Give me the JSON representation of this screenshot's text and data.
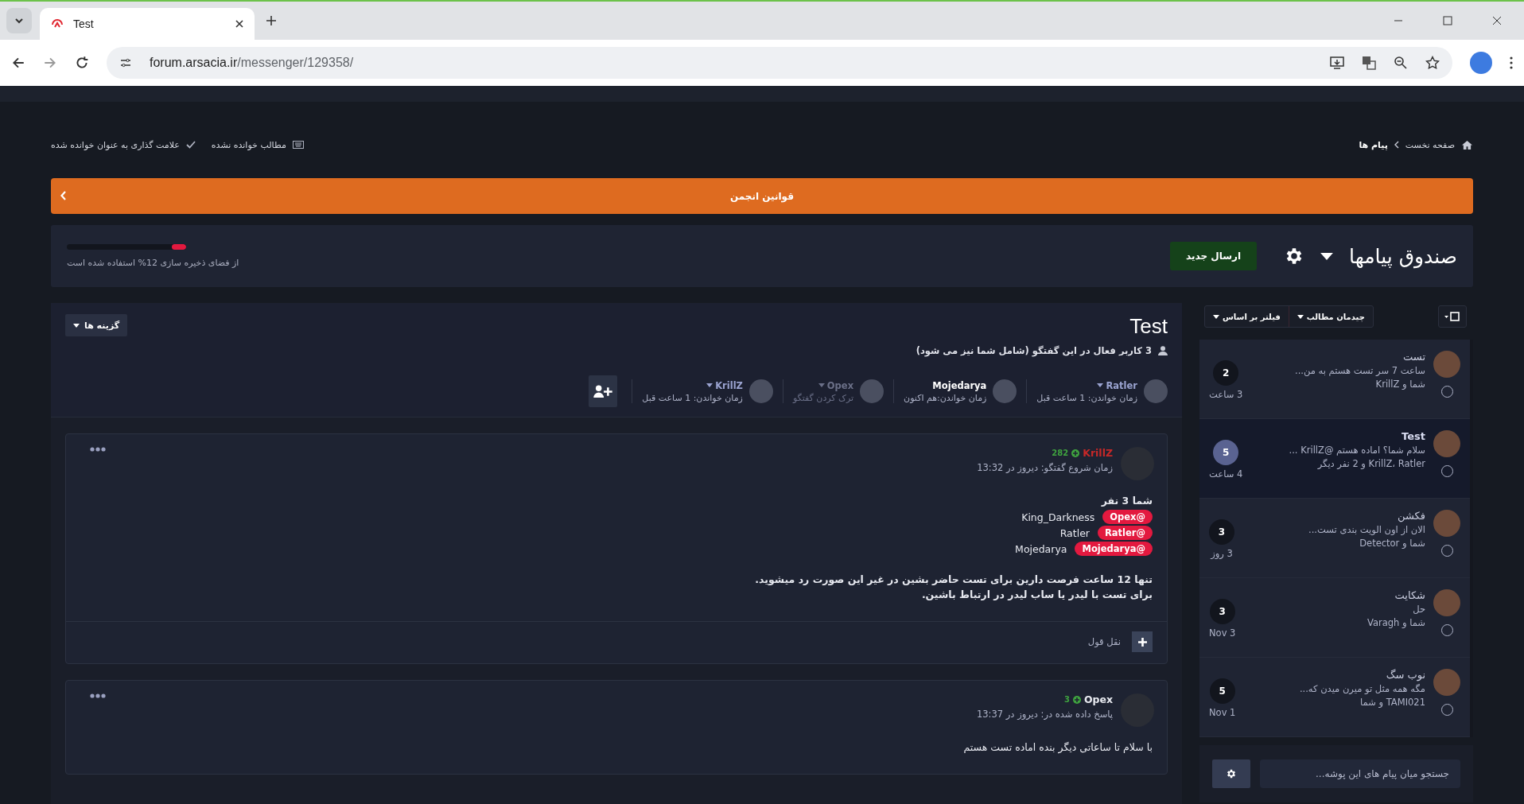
{
  "browser": {
    "tabs": [
      {
        "title": "Test",
        "selected": true
      }
    ],
    "url_host": "forum.arsacia.ir",
    "url_path": "/messenger/129358/"
  },
  "breadcrumb": [
    {
      "label": "صفحه نخست",
      "current": false
    },
    {
      "label": "پیام ها",
      "current": true
    }
  ],
  "top_links": [
    {
      "kind": "unread",
      "label": "مطالب خوانده نشده"
    },
    {
      "kind": "mark",
      "label": "علامت گذاری به عنوان خوانده شده"
    }
  ],
  "notice": {
    "label": "قوانین انجمن"
  },
  "inbox": {
    "title": "صندوق پیامها",
    "new_button": "ارسال جدید",
    "storage": {
      "level": 0.12,
      "text": "از فضای ذخیره سازی 12% استفاده شده است"
    }
  },
  "sidebar": {
    "toolbar": [
      "چیدمان مطالب",
      "فیلتر بر اساس"
    ],
    "conversations": [
      {
        "title": "تست",
        "snippet": "ساعت 7 سر تست هستم به من...",
        "participants": "شما و KrillZ",
        "count": "2",
        "time": "3 ساعت",
        "selected": false,
        "checked": false
      },
      {
        "title": "Test",
        "snippet": "سلام شما؟ اماده هستم @KrillZ ...",
        "participants": "KrillZ، Ratler و 2 نفر دیگر",
        "count": "5",
        "time": "4 ساعت",
        "selected": true,
        "checked": false
      },
      {
        "title": "فکشن",
        "snippet": "الان از اون الویت بندی تست...",
        "participants": "شما و Detector",
        "count": "3",
        "time": "3 روز",
        "selected": false,
        "checked": false
      },
      {
        "title": "شکایت",
        "snippet": "حل",
        "participants": "شما و Varagh",
        "count": "3",
        "time": "Nov 3",
        "selected": false,
        "checked": false
      },
      {
        "title": "نوب سگ",
        "snippet": "مگه همه مثل تو میرن میدن که...",
        "participants": "TAMI021 و شما",
        "count": "5",
        "time": "Nov 1",
        "selected": false,
        "checked": false
      }
    ],
    "search": {
      "placeholder": "جستجو میان پیام های این پوشه..."
    }
  },
  "conversation": {
    "title": "Test",
    "active_users": "3 کاربر فعال در این گفتگو (شامل شما نیز می شود)",
    "options_button": "گزینه ها",
    "participants": [
      {
        "name": "Ratler",
        "status": "زمان خواندن: 1 ساعت قبل",
        "has_menu": true,
        "left": false
      },
      {
        "name": "Mojedarya",
        "status": "زمان خواندن:هم اکنون",
        "has_menu": false,
        "left": false
      },
      {
        "name": "Opex",
        "status": "ترک کردن گفتگو",
        "has_menu": true,
        "left": true
      },
      {
        "name": "KrillZ",
        "status": "زمان خواندن: 1 ساعت قبل",
        "has_menu": true,
        "left": false
      }
    ]
  },
  "messages": [
    {
      "author": "KrillZ",
      "color": "#c62828",
      "reputation": "282",
      "meta": "زمان شروع گفتگو: دیروز در 13:32",
      "intro": "شما 3 نفر",
      "mentions": [
        {
          "tag": "@Opex",
          "name": "King_Darkness"
        },
        {
          "tag": "@Ratler",
          "name": "Ratler"
        },
        {
          "tag": "@Mojedarya",
          "name": "Mojedarya"
        }
      ],
      "lines": [
        "تنها 12 ساعت فرصت دارین برای تست حاضر بشین در غیر این صورت رد میشوید.",
        "برای تست با لیدر یا ساب لیدر در ارتباط باشین."
      ],
      "quote": "نقل قول"
    },
    {
      "author": "Opex",
      "color": "#e8eaf0",
      "reputation": "3",
      "meta": "پاسخ داده شده در: دیروز در 13:37",
      "intro": "با سلام تا ساعاتی دیگر بنده اماده تست هستم"
    }
  ]
}
